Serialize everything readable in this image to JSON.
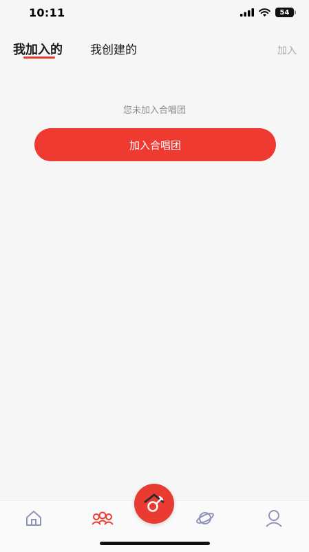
{
  "status": {
    "time": "10:11",
    "battery": "54"
  },
  "tabs": {
    "joined": "我加入的",
    "created": "我创建的"
  },
  "header": {
    "join_link": "加入"
  },
  "empty_state": {
    "message": "您未加入合唱团",
    "button_label": "加入合唱团"
  },
  "tabbar": {
    "items": [
      "home-icon",
      "choir-icon",
      "create-icon",
      "planet-icon",
      "profile-icon"
    ],
    "active": "choir-icon",
    "accent": "#ef3a31",
    "inactive_color": "#8f93b8"
  }
}
